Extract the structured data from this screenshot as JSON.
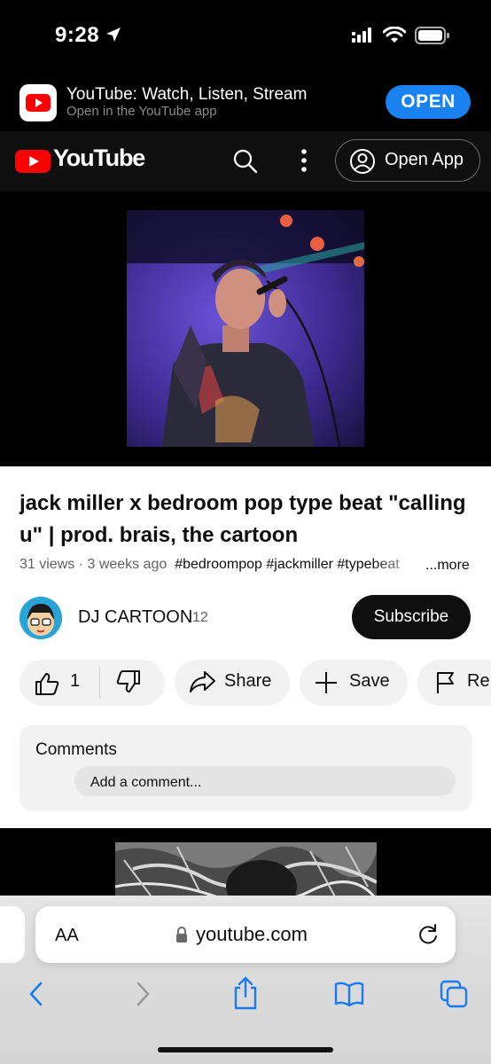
{
  "status_bar": {
    "time": "9:28"
  },
  "smart_banner": {
    "app_title": "YouTube: Watch, Listen, Stream",
    "app_subtitle": "Open in the YouTube app",
    "open_label": "OPEN"
  },
  "yt_header": {
    "logo_text": "YouTube",
    "open_app_label": "Open App"
  },
  "video": {
    "title": "jack miller x bedroom pop type beat \"calling u\" | prod. brais, the cartoon",
    "views": "31 views",
    "age": "3 weeks ago",
    "hashtags": "#bedroompop #jackmiller #typebeat",
    "more_label": "...more"
  },
  "channel": {
    "name": "DJ CARTOON",
    "subscriber_count": "12",
    "subscribe_label": "Subscribe"
  },
  "actions": {
    "like_count": "1",
    "share_label": "Share",
    "save_label": "Save",
    "report_label": "Report"
  },
  "comments": {
    "heading": "Comments",
    "placeholder": "Add a comment..."
  },
  "safari": {
    "text_size_label": "AA",
    "url": "youtube.com"
  },
  "colors": {
    "youtube_red": "#ff0000",
    "open_button_blue": "#1a82f0",
    "safari_tint": "#1a7bf2"
  }
}
